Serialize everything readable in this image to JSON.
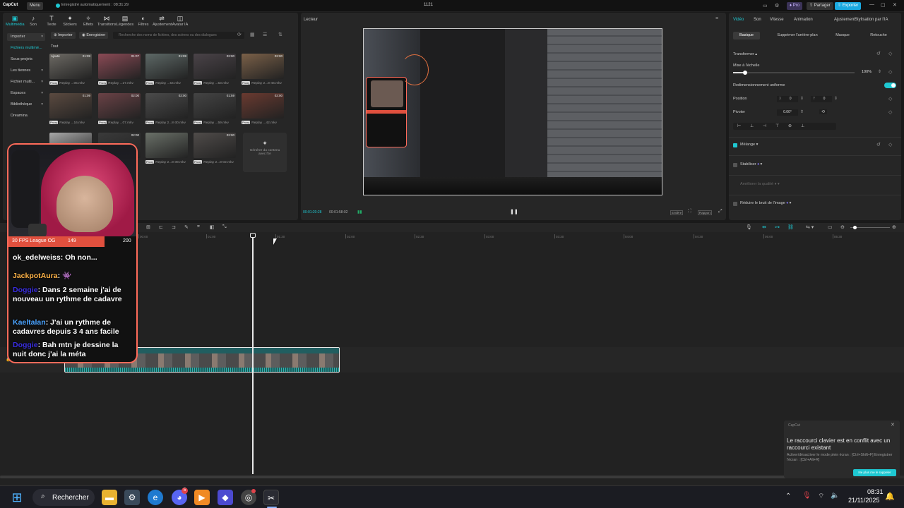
{
  "titlebar": {
    "logo": "CapCut",
    "menu": "Menu",
    "autosave": "Enregistré automatiquement : 08:31:29",
    "project": "1121",
    "pro": "Pro",
    "share": "Partager",
    "export": "Exporter"
  },
  "media_tools": [
    {
      "icon": "▣",
      "label": "Multimédia",
      "name": "multimedia"
    },
    {
      "icon": "♪",
      "label": "Son",
      "name": "son"
    },
    {
      "icon": "T",
      "label": "Texte",
      "name": "texte"
    },
    {
      "icon": "✦",
      "label": "Stickers",
      "name": "stickers"
    },
    {
      "icon": "✧",
      "label": "Effets",
      "name": "effets"
    },
    {
      "icon": "⋈",
      "label": "Transitions",
      "name": "transitions"
    },
    {
      "icon": "▤",
      "label": "Légendes",
      "name": "legendes"
    },
    {
      "icon": "◐",
      "label": "Filtres",
      "name": "filtres"
    },
    {
      "icon": "⇌",
      "label": "Ajustement",
      "name": "ajustement"
    },
    {
      "icon": "◫",
      "label": "Avatar IA",
      "name": "avatar-ia"
    }
  ],
  "sidebar": [
    "Importer",
    "Fichiers multimé...",
    "Sous-projets",
    "Les tiennes",
    "Fichier multi...",
    "Espaces",
    "Bibliothèque",
    "Dreamina"
  ],
  "media_toolbar": {
    "import": "Importer",
    "record": "Enregistrer",
    "search_placeholder": "Recherche des noms de fichiers, des scènes ou des dialogues"
  },
  "filter_label": "Tout",
  "thumbs": [
    {
      "dur": "01:09",
      "label": "Replay ...05.mkv",
      "tag": "Ajouté",
      "color": "#6d6a64"
    },
    {
      "dur": "01:07",
      "label": "Replay ...27.mkv",
      "tag": "",
      "color": "#8a4a55"
    },
    {
      "dur": "01:09",
      "label": "Replay ...54.mkv",
      "tag": "",
      "color": "#5d6866"
    },
    {
      "dur": "02:00",
      "label": "Replay ...53.mkv",
      "tag": "",
      "color": "#4a4348"
    },
    {
      "dur": "02:00",
      "label": "Replay 2...8-46.mkv",
      "tag": "",
      "color": "#7a6048"
    },
    {
      "dur": "01:09",
      "label": "Replay ...16.mkv",
      "tag": "",
      "color": "#5b4a40"
    },
    {
      "dur": "02:00",
      "label": "Replay ...07.mkv",
      "tag": "",
      "color": "#6a4246"
    },
    {
      "dur": "02:00",
      "label": "Replay 2...8-30.mkv",
      "tag": "",
      "color": "#4b4b4b"
    },
    {
      "dur": "01:59",
      "label": "Replay ...59.mkv",
      "tag": "",
      "color": "#444"
    },
    {
      "dur": "02:00",
      "label": "Replay ...42.mkv",
      "tag": "",
      "color": "#6a3a30"
    },
    {
      "dur": "",
      "label": "",
      "tag": "",
      "color": "#a8a8a8"
    },
    {
      "dur": "02:00",
      "label": "",
      "tag": "",
      "color": "#3a3a3a"
    },
    {
      "dur": "",
      "label": "Replay 2...8-39.mkv",
      "tag": "",
      "color": "#6a7068"
    },
    {
      "dur": "02:00",
      "label": "Replay 2...8-02.mkv",
      "tag": "",
      "color": "#504c4a"
    }
  ],
  "ai_card": "Générer du contenu avec l'IA",
  "player": {
    "title": "Lecteur",
    "current_time": "00:01:20:28",
    "total_time": "00:01:58:02",
    "fit": "Entière",
    "ratio": "Rapport"
  },
  "props": {
    "tabs": [
      "Vidéo",
      "Son",
      "Vitesse",
      "Animation",
      "Ajustement",
      "Stylisation par l'IA"
    ],
    "subtabs": [
      "Basique",
      "Supprimer l'arrière-plan",
      "Masque",
      "Retouche"
    ],
    "transform": "Transformer",
    "scale_label": "Mise à l'échelle",
    "scale_value": "100%",
    "scale_fraction": 0.1,
    "uniform": "Redimensionnement uniforme",
    "position": "Position",
    "pos_x_label": "X",
    "pos_x": "0",
    "pos_y_label": "Y",
    "pos_y": "0",
    "rotate": "Pivoter",
    "rotate_value": "0.00°",
    "blend": "Mélange",
    "stabilize": "Stabiliser",
    "quality": "Améliorer la qualité",
    "denoise": "Réduire le bruit de l'image"
  },
  "timeline": {
    "ticks": [
      "00:00",
      "01:00",
      "01:30",
      "02:00",
      "02:30",
      "03:00",
      "03:30",
      "04:00",
      "04:30",
      "05:00",
      "05:30"
    ],
    "clip_label": "Replay 2025-11-21 08-18-35.mkv   00:01:58:02"
  },
  "overlay": {
    "label": "30 FPS League OG",
    "count1": "149",
    "count2": "200",
    "chat": [
      {
        "user": "ok_edelweiss",
        "user_color": "#ffffff",
        "msg": ": Oh non..."
      },
      {
        "user": "JackpotAura",
        "user_color": "#ffb347",
        "msg": ": 👾"
      },
      {
        "user": "Doggie",
        "user_color": "#3a2ee0",
        "msg": ": Dans 2 semaine j'ai de nouveau un rythme de cadavre"
      },
      {
        "user": "Kaeltalan",
        "user_color": "#4aa3ff",
        "msg": ": J'ai un rythme de cadavres depuis 3 4 ans facile"
      },
      {
        "user": "Doggie",
        "user_color": "#3a2ee0",
        "msg": ": Bah mtn je dessine la nuit donc j'ai la méta"
      }
    ]
  },
  "toast": {
    "app": "CapCut",
    "title": "Le raccourci clavier est en conflit avec un raccourci existant",
    "body": "Activer/désactiver le mode plein écran : [Ctrl+Shift+F] Enregistrer l'écran : [Ctrl+Alt+R]",
    "action": "Ne plus me le rappeler"
  },
  "taskbar": {
    "search": "Rechercher",
    "time": "08:31",
    "date": "21/11/2025",
    "discord_badge": "5"
  },
  "colors": {
    "accent": "#1ec8d2",
    "export": "#1aa9e0",
    "overlay_border": "#ff6b5a"
  }
}
